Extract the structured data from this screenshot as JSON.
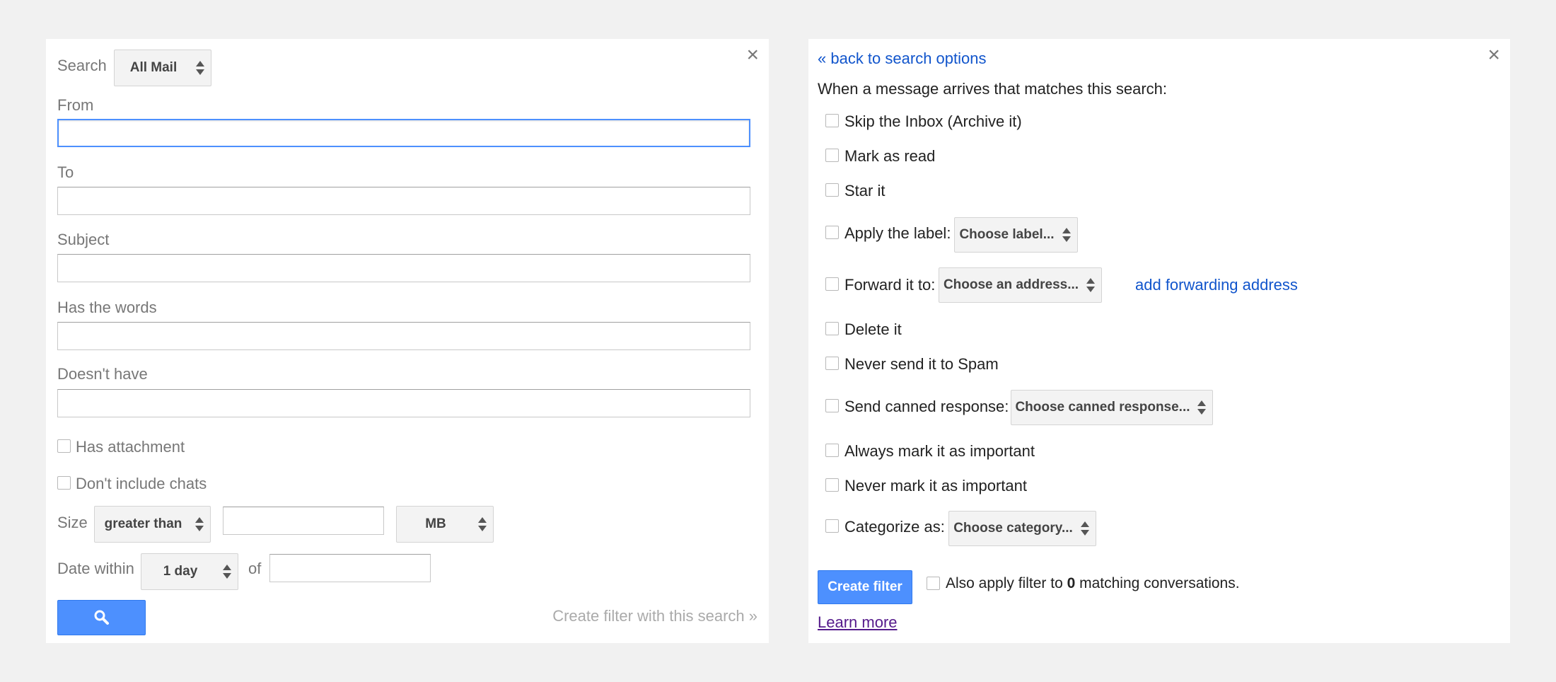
{
  "search_panel": {
    "close_glyph": "×",
    "search_label": "Search",
    "scope_select": "All Mail",
    "from_label": "From",
    "from_value": "",
    "to_label": "To",
    "to_value": "",
    "subject_label": "Subject",
    "subject_value": "",
    "has_words_label": "Has the words",
    "has_words_value": "",
    "doesnt_have_label": "Doesn't have",
    "doesnt_have_value": "",
    "has_attachment_label": "Has attachment",
    "no_chats_label": "Don't include chats",
    "size_label": "Size",
    "size_operator": "greater than",
    "size_value": "",
    "size_unit": "MB",
    "date_within_label": "Date within",
    "date_within_select": "1 day",
    "of_label": "of",
    "date_value": "",
    "search_button_icon": "search-icon",
    "create_filter_link": "Create filter with this search »"
  },
  "filter_panel": {
    "close_glyph": "×",
    "back_link": "« back to search options",
    "heading": "When a message arrives that matches this search:",
    "actions": {
      "skip_inbox": "Skip the Inbox (Archive it)",
      "mark_read": "Mark as read",
      "star": "Star it",
      "apply_label": "Apply the label:",
      "apply_label_select": "Choose label...",
      "forward": "Forward it to:",
      "forward_select": "Choose an address...",
      "add_forwarding": "add forwarding address",
      "delete": "Delete it",
      "never_spam": "Never send it to Spam",
      "canned": "Send canned response:",
      "canned_select": "Choose canned response...",
      "always_important": "Always mark it as important",
      "never_important": "Never mark it as important",
      "categorize": "Categorize as:",
      "categorize_select": "Choose category..."
    },
    "create_button": "Create filter",
    "also_apply_prefix": "Also apply filter to ",
    "also_apply_count": "0",
    "also_apply_suffix": " matching conversations.",
    "learn_more": "Learn more"
  },
  "colors": {
    "background": "#f1f1f1",
    "link": "#1155cc",
    "primary_button": "#4d90fe",
    "focus_border": "#4d90fe"
  }
}
